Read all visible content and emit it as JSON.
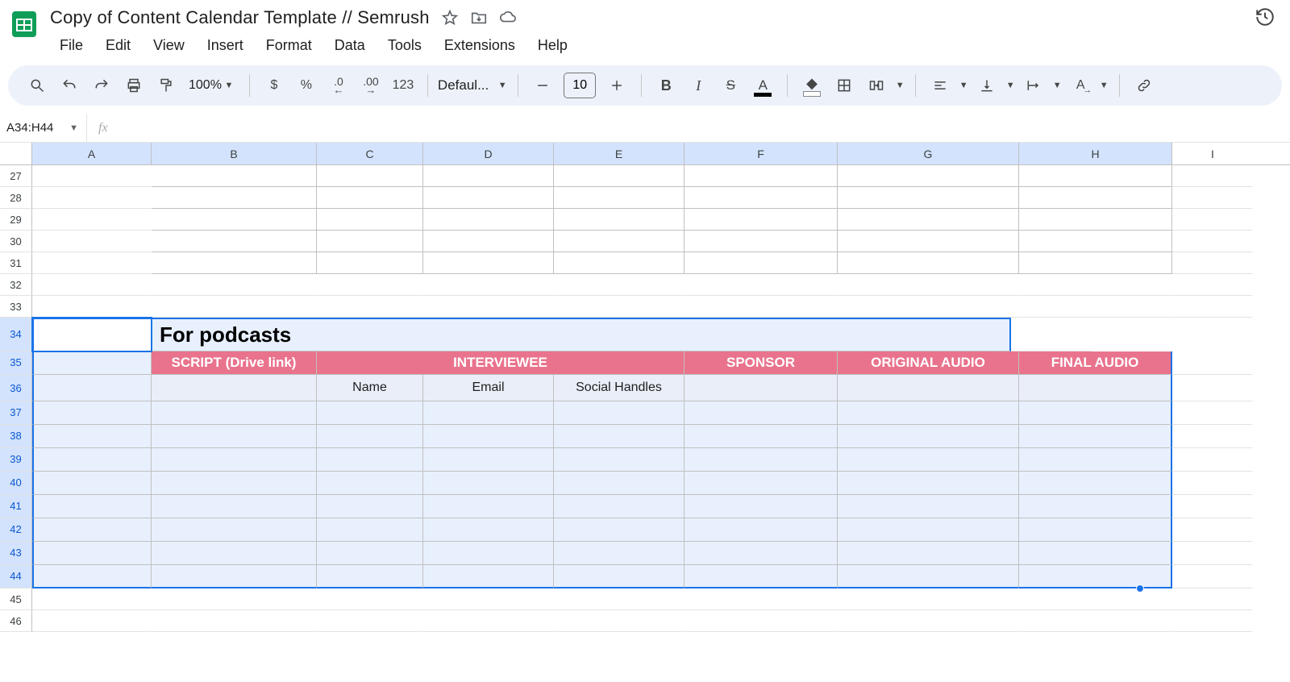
{
  "doc": {
    "title": "Copy of Content Calendar Template // Semrush"
  },
  "menu": {
    "file": "File",
    "edit": "Edit",
    "view": "View",
    "insert": "Insert",
    "format": "Format",
    "data": "Data",
    "tools": "Tools",
    "extensions": "Extensions",
    "help": "Help"
  },
  "toolbar": {
    "zoom": "100%",
    "currency": "$",
    "percent": "%",
    "dec_dec": ".0",
    "dec_inc": ".00",
    "numfmt": "123",
    "font": "Defaul...",
    "fontsize": "10"
  },
  "namebox": {
    "value": "A34:H44"
  },
  "cols": [
    "A",
    "B",
    "C",
    "D",
    "E",
    "F",
    "G",
    "H",
    "I"
  ],
  "rows": [
    "27",
    "28",
    "29",
    "30",
    "31",
    "32",
    "33",
    "34",
    "35",
    "36",
    "37",
    "38",
    "39",
    "40",
    "41",
    "42",
    "43",
    "44",
    "45",
    "46"
  ],
  "content": {
    "title": "For podcasts",
    "headers": {
      "script": "SCRIPT (Drive link)",
      "interviewee": "INTERVIEWEE",
      "sponsor": "SPONSOR",
      "orig_audio": "ORIGINAL AUDIO",
      "final_audio": "FINAL AUDIO"
    },
    "sub": {
      "name": "Name",
      "email": "Email",
      "social": "Social Handles"
    }
  }
}
